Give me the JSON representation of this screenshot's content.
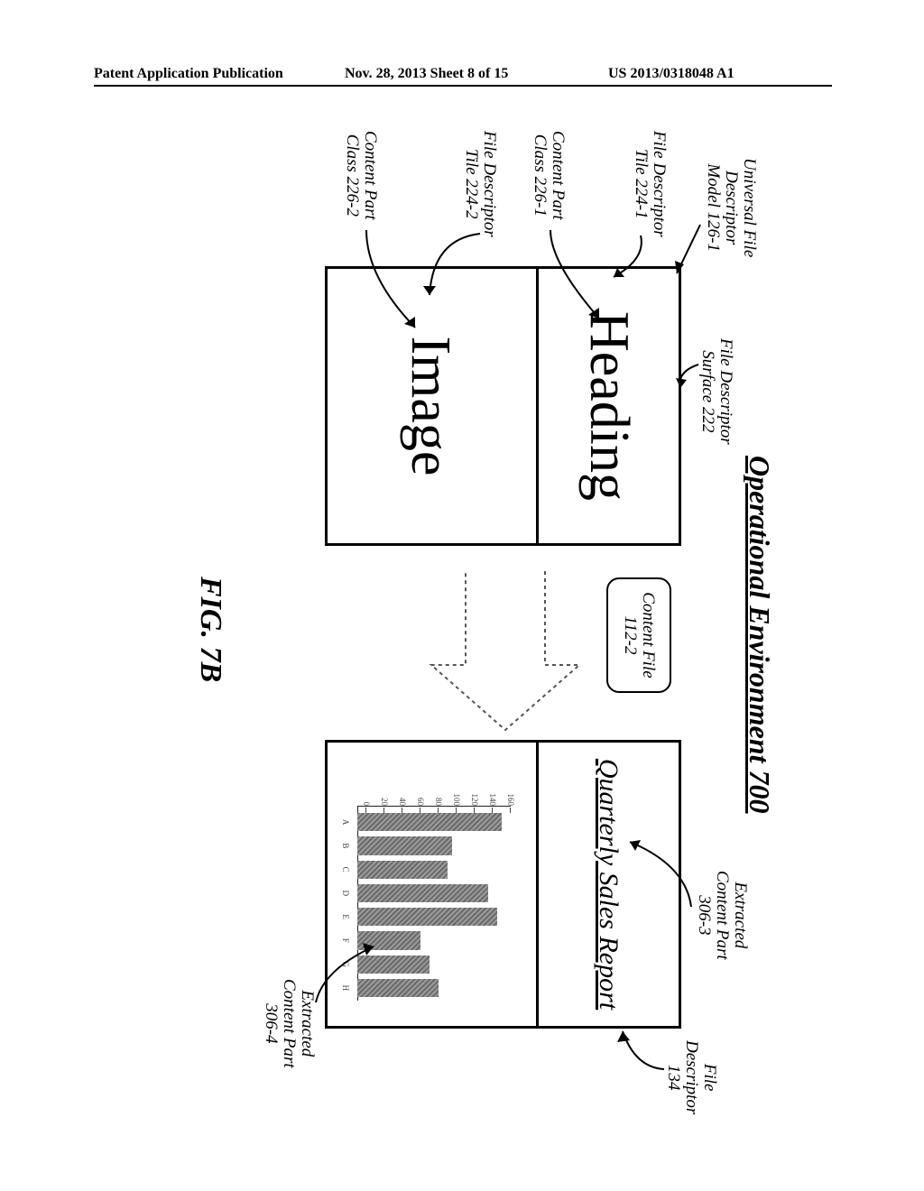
{
  "header": {
    "left": "Patent Application Publication",
    "middle": "Nov. 28, 2013  Sheet 8 of 15",
    "right": "US 2013/0318048 A1"
  },
  "diagram": {
    "title": "Operational Environment 700",
    "left_box": {
      "tile1": "Heading",
      "tile2": "Image"
    },
    "content_file": "Content\nFile 112-2",
    "right_box": {
      "title_text": "Quarterly Sales Report"
    },
    "callouts": {
      "ufdm": "Universal File\nDescriptor\nModel 126-1",
      "fds": "File Descriptor\nSurface 222",
      "fdt1": "File Descriptor\nTile 224-1",
      "cpc1": "Content Part\nClass 226-1",
      "fdt2": "File Descriptor\nTile 224-2",
      "cpc2": "Content Part\nClass 226-2",
      "ecp3": "Extracted\nContent Part\n306-3",
      "fd134": "File\nDescriptor\n134",
      "ecp4": "Extracted\nContent Part\n306-4"
    },
    "figure_label": "FIG. 7B"
  },
  "chart_data": {
    "type": "bar",
    "title": "",
    "xlabel": "",
    "ylabel": "",
    "categories": [
      "A",
      "B",
      "C",
      "D",
      "E",
      "F",
      "G",
      "H"
    ],
    "values": [
      160,
      105,
      100,
      145,
      155,
      70,
      80,
      90
    ],
    "yticks": [
      0,
      20,
      40,
      60,
      80,
      100,
      120,
      140,
      160
    ],
    "ylim": [
      0,
      170
    ]
  }
}
